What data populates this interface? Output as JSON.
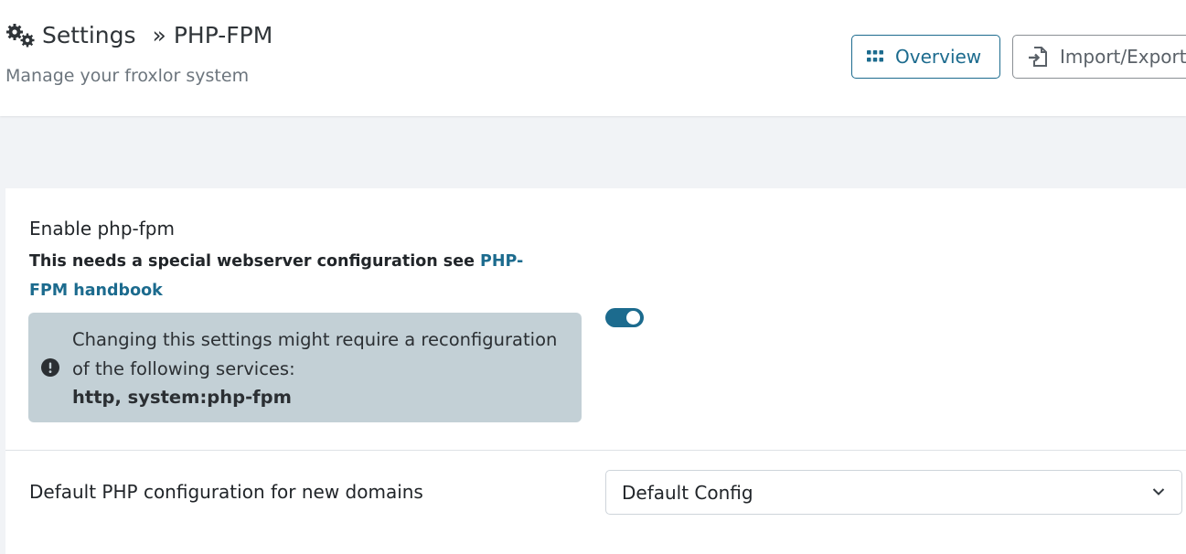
{
  "header": {
    "title": "Settings",
    "separator": "»",
    "section": "PHP-FPM",
    "subtitle": "Manage your froxlor system",
    "icon": "gears-icon"
  },
  "toolbar": {
    "overview_label": "Overview",
    "overview_icon": "grid-icon",
    "import_label": "Import/Export",
    "import_icon": "file-import-icon"
  },
  "settings": {
    "enable_fpm": {
      "label": "Enable php-fpm",
      "desc_prefix": "This needs a special webserver configuration see ",
      "desc_link": "PHP-FPM handbook",
      "enabled": true,
      "alert_text": "Changing this settings might require a reconfiguration of the following services:",
      "alert_services": "http, system:php-fpm",
      "alert_icon": "exclamation-circle-icon"
    },
    "default_config": {
      "label": "Default PHP configuration for new domains",
      "selected": "Default Config"
    }
  },
  "colors": {
    "accent": "#1c6b8e",
    "alert_bg": "#c3d0d6",
    "page_bg": "#f1f3f6"
  }
}
